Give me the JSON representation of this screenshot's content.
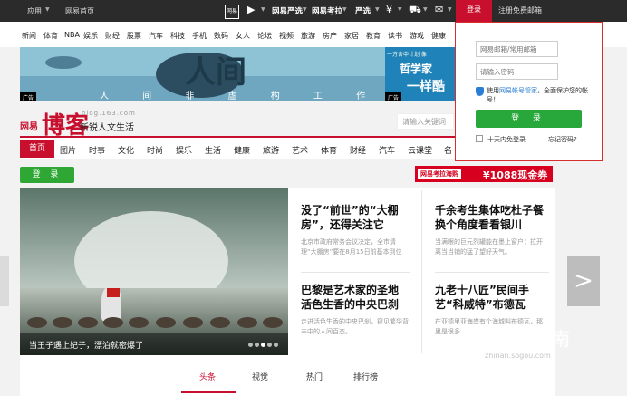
{
  "topbar": {
    "app": "应用",
    "home": "网易首页",
    "icon_title": "网易",
    "nav1": "网易严选",
    "nav2": "网易考拉",
    "nav3": "严选",
    "login_label": "登录",
    "register_label": "注册免费邮箱"
  },
  "nav_links": [
    "新闻",
    "体育",
    "NBA",
    "娱乐",
    "财经",
    "股票",
    "汽车",
    "科技",
    "手机",
    "数码",
    "女人",
    "论坛",
    "视频",
    "旅游",
    "房产",
    "家居",
    "教育",
    "读书",
    "游戏",
    "健康"
  ],
  "banner": {
    "title": "人间",
    "subtitle": "人 间 非 虚 构 工 作 室",
    "ad_label": "广告",
    "right_line1": "一方舍中计划 像",
    "right_line2": "哲学家",
    "right_line3": "一样酷",
    "right_ad_label": "广告"
  },
  "logo": {
    "brand": "网易",
    "name": "博客",
    "domain": "blog.163.com",
    "slogan": "新锐人文生活"
  },
  "search": {
    "placeholder": "请输入关键词"
  },
  "categories": [
    "首页",
    "图片",
    "时事",
    "文化",
    "时尚",
    "娱乐",
    "生活",
    "健康",
    "旅游",
    "艺术",
    "体育",
    "财经",
    "汽车",
    "云课堂",
    "名"
  ],
  "login_button": "登 录",
  "promo": {
    "tag": "网易考拉海购",
    "text": "¥1088现金券"
  },
  "hero": {
    "caption": "当王子遇上妃子，漂泊就密爆了"
  },
  "articles": [
    {
      "title": "没了“前世”的“大棚房”，还得关注它",
      "desc": "北京市政府常务会议决定，全市清理“大棚房”要在8月15日前基本到位"
    },
    {
      "title": "千余考生集体吃杜子餐换个角度看看银川",
      "desc": "当满眼的巨元烈罐能在墨上窗户：拉开离当当铺的猛了望好天气。"
    },
    {
      "title": "巴黎是艺术家的圣地 活色生香的中央巴刹",
      "desc": "走进活色生香的中央巴刹，窥见繁华背丰中的人间百态。"
    },
    {
      "title": "九老十八匠”民间手艺“科威特”布德瓦",
      "desc": "在亚德里亚海岸有个海城叫布德瓦，那里是很多"
    }
  ],
  "bottom_tabs": [
    "头条",
    "视觉",
    "热门",
    "排行榜"
  ],
  "popup": {
    "email_placeholder": "网易邮箱/常用邮箱",
    "password_placeholder": "请输入密码",
    "note_prefix": "使用",
    "note_link": "网易帐号管家",
    "note_suffix": "，全面保护您的帐号！",
    "login_button": "登 录",
    "auto_login": "十天内免登录",
    "forgot": "忘记密码?"
  },
  "watermark": {
    "title": "搜狗指南",
    "url": "zhinan.sogou.com"
  }
}
